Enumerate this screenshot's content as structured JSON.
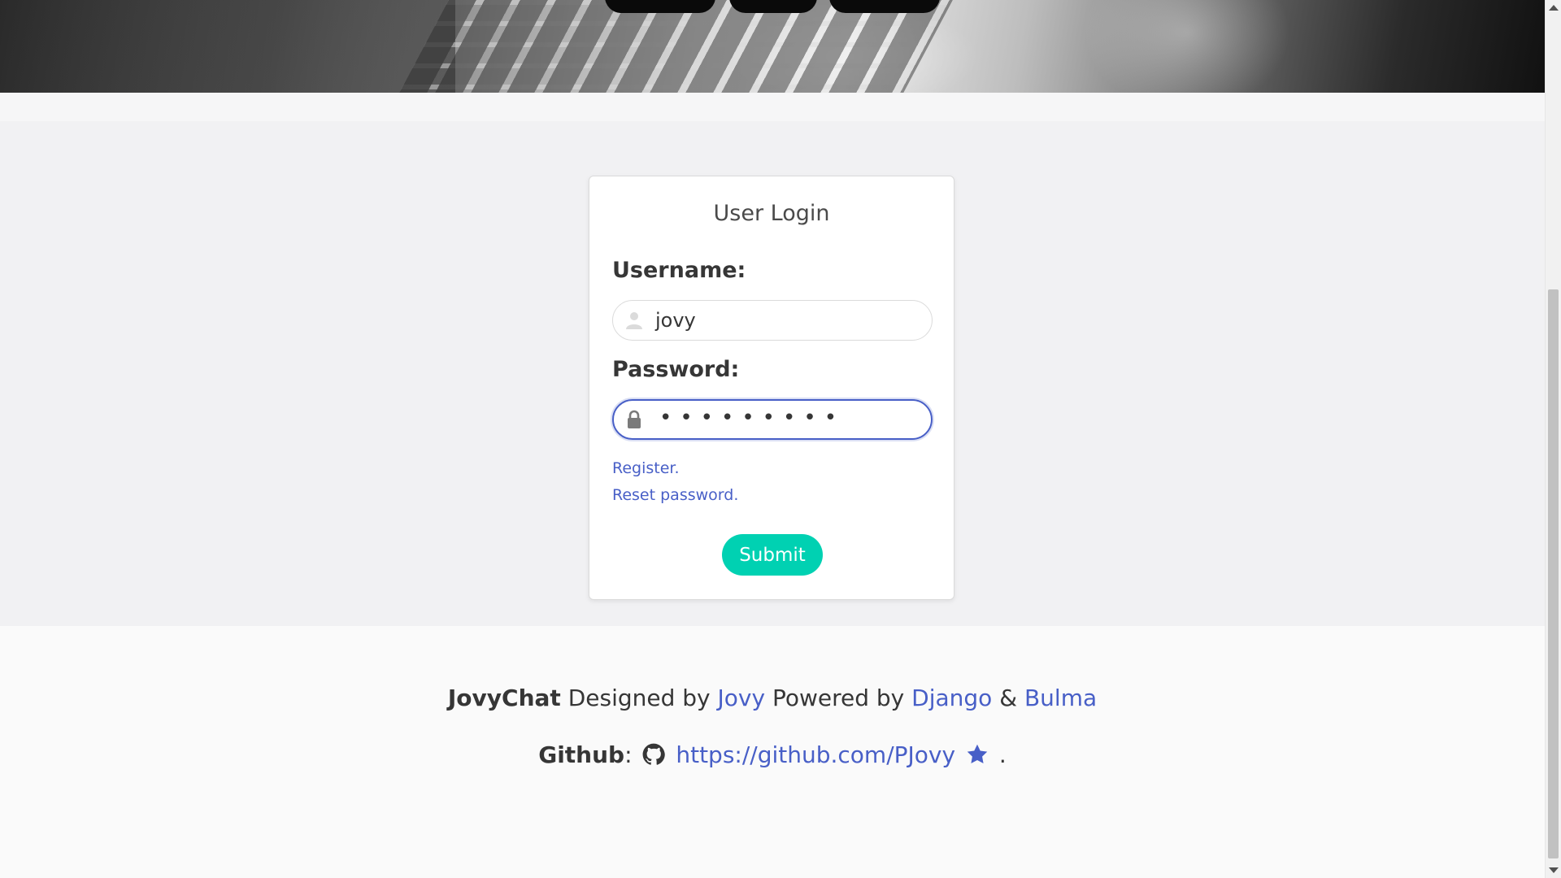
{
  "login": {
    "title": "User Login",
    "username_label": "Username:",
    "username_value": "jovy",
    "password_label": "Password:",
    "password_masked": "•••••••••",
    "register_link": "Register.",
    "reset_link": "Reset password.",
    "submit_label": "Submit"
  },
  "footer": {
    "brand": "JovyChat",
    "designed_by_text": "Designed by",
    "designer": "Jovy",
    "powered_by_text": "Powered by",
    "framework": "Django",
    "ampersand": "&",
    "css_framework": "Bulma",
    "github_label": "Github",
    "github_colon": ":",
    "github_url": "https://github.com/PJovy",
    "period": "."
  },
  "icons": {
    "username": "user-icon",
    "password": "lock-icon",
    "github": "github-icon",
    "star": "star-icon"
  },
  "colors": {
    "link": "#485fc7",
    "submit": "#00d1b2",
    "focus_border": "#485fc7"
  }
}
